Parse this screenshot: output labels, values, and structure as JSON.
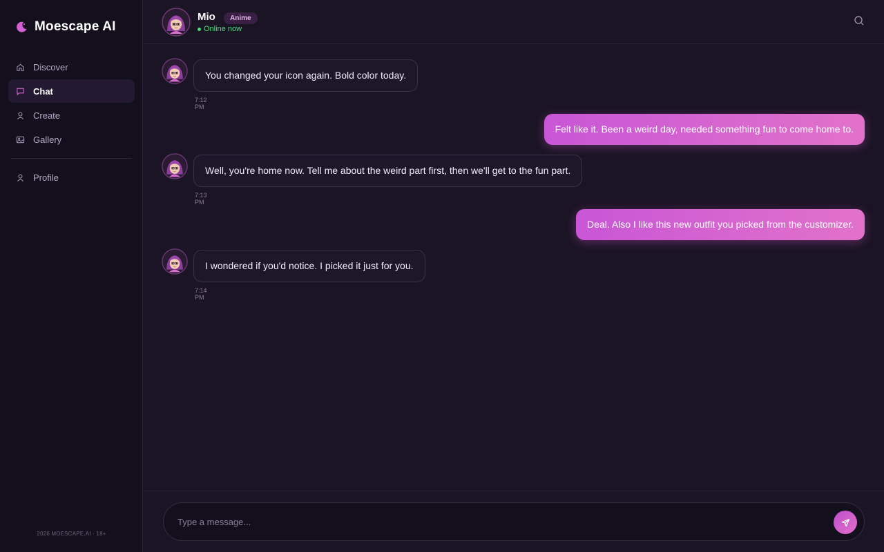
{
  "app": {
    "name": "Moescape AI",
    "footer": "2026 MOESCAPE.AI · 18+"
  },
  "sidebar": {
    "items": [
      {
        "label": "Discover",
        "icon": "home-icon",
        "active": false
      },
      {
        "label": "Chat",
        "icon": "chat-icon",
        "active": true
      },
      {
        "label": "Create",
        "icon": "user-icon",
        "active": false
      },
      {
        "label": "Gallery",
        "icon": "image-icon",
        "active": false
      }
    ],
    "secondary": [
      {
        "label": "Profile",
        "icon": "user-icon",
        "active": false
      }
    ]
  },
  "header": {
    "name": "Mio",
    "tag": "Anime",
    "status": "Online now"
  },
  "messages": [
    {
      "from": "ai",
      "text": "You changed your icon again. Bold color today.",
      "time": "7:12 PM"
    },
    {
      "from": "user",
      "text": "Felt like it. Been a weird day, needed something fun to come home to."
    },
    {
      "from": "ai",
      "text": "Well, you're home now. Tell me about the weird part first, then we'll get to the fun part.",
      "time": "7:13 PM"
    },
    {
      "from": "user",
      "text": "Deal. Also I like this new outfit you picked from the customizer."
    },
    {
      "from": "ai",
      "text": "I wondered if you'd notice. I picked it just for you.",
      "time": "7:14 PM"
    }
  ],
  "composer": {
    "placeholder": "Type a message..."
  },
  "colors": {
    "accent": "#d35fd2",
    "online": "#4ade80",
    "background": "#1b1425",
    "sidebar": "#140f1c"
  }
}
